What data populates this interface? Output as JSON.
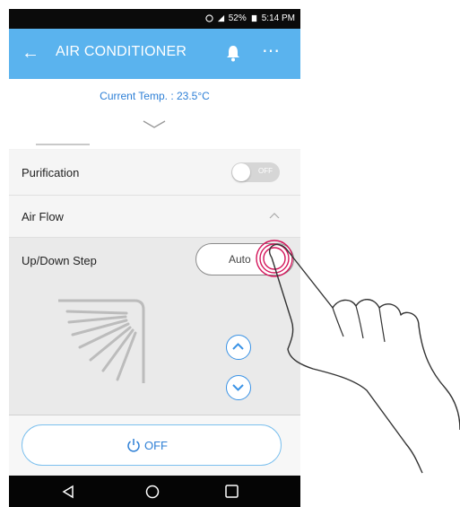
{
  "status_bar": {
    "battery": "52%",
    "time": "5:14 PM"
  },
  "app_bar": {
    "title": "AIR CONDITIONER"
  },
  "current_temp": "Current Temp. : 23.5°C",
  "purification": {
    "label": "Purification",
    "toggle_text": "OFF"
  },
  "air_flow": {
    "label": "Air Flow"
  },
  "updown_step": {
    "label": "Up/Down Step",
    "value": "Auto"
  },
  "power": {
    "label": "OFF"
  },
  "colors": {
    "app_bar": "#5ab3ee",
    "accent": "#2d7fd6",
    "touch": "#d4145a"
  }
}
